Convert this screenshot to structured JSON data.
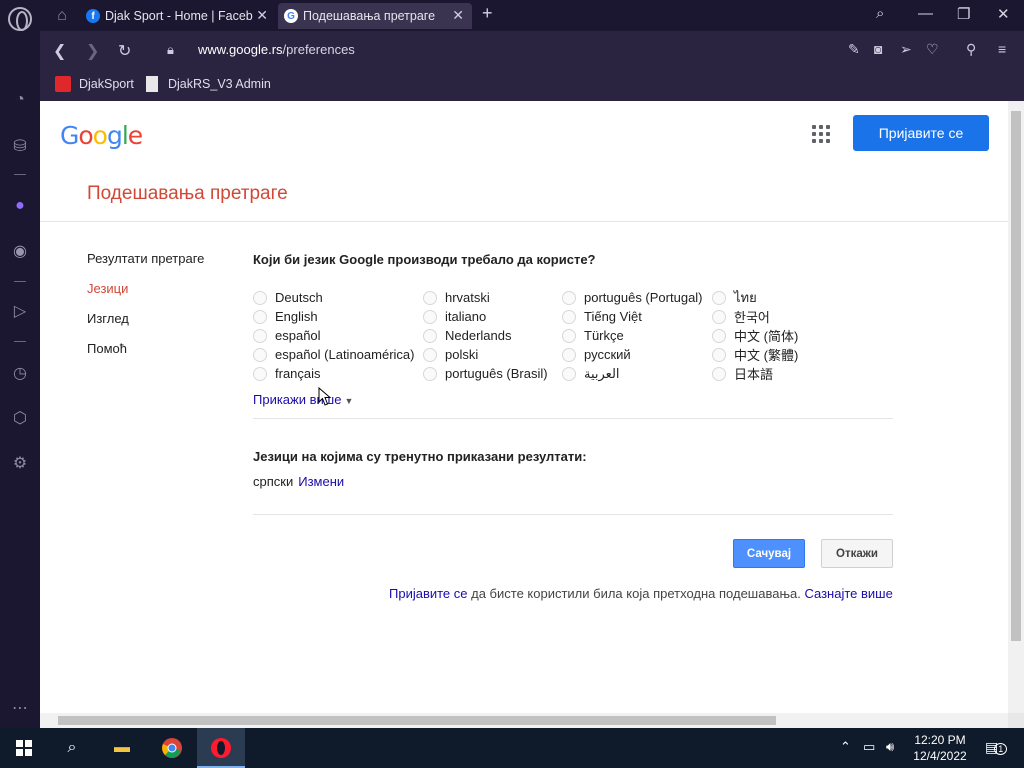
{
  "tabs": [
    {
      "label": "Djak Sport - Home | Facebo",
      "favicon": "facebook-icon"
    },
    {
      "label": "Подешавања претраге",
      "favicon": "google-icon"
    }
  ],
  "address_bar": {
    "url_host": "www.google.rs",
    "url_path": "/preferences"
  },
  "bookmarks": [
    {
      "label": "DjakSport"
    },
    {
      "label": "DjakRS_V3 Admin"
    }
  ],
  "google": {
    "logo_text": "Google",
    "signin_button": "Пријавите се",
    "page_title": "Подешавања претраге",
    "nav": [
      "Резултати претраге",
      "Језици",
      "Изглед",
      "Помоћ"
    ],
    "language_question": "Који би језик Google производи требало да користе?",
    "languages": [
      [
        "Deutsch",
        "English",
        "español",
        "español (Latinoamérica)",
        "français"
      ],
      [
        "hrvatski",
        "italiano",
        "Nederlands",
        "polski",
        "português (Brasil)"
      ],
      [
        "português (Portugal)",
        "Tiếng Việt",
        "Türkçe",
        "русский",
        "العربية"
      ],
      [
        "ไทย",
        "한국어",
        "中文 (简体)",
        "中文 (繁體)",
        "日本語"
      ]
    ],
    "show_more": "Прикажи више",
    "current_results_heading": "Језици на којима су тренутно приказани резултати:",
    "current_language": "српски",
    "change_link": "Измени",
    "save_button": "Сачувај",
    "cancel_button": "Откажи",
    "footer_signin_link": "Пријавите се",
    "footer_text": " да бисте користили била која претходна подешавања. ",
    "footer_learn_more": "Сазнајте више"
  },
  "taskbar": {
    "time": "12:20 PM",
    "date": "12/4/2022",
    "notification_count": "1"
  },
  "colors": {
    "accent_blue": "#1a73e8",
    "title_red": "#d14836",
    "link": "#1a0dab",
    "opera_red": "#ff1b2d"
  }
}
